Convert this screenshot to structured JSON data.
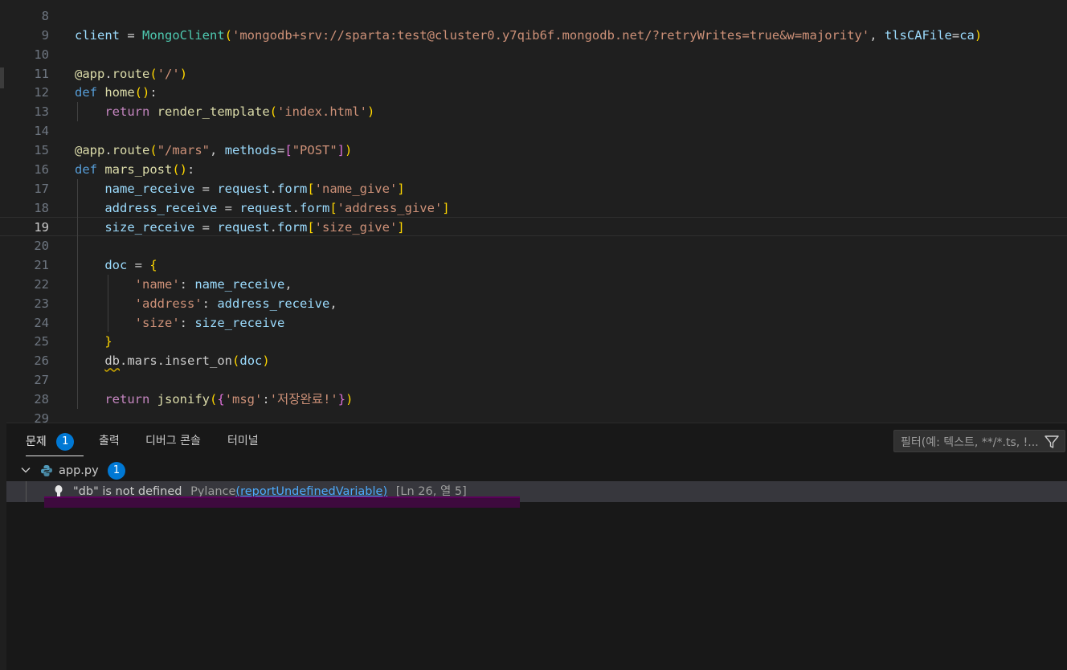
{
  "editor": {
    "lines": [
      {
        "n": "8",
        "segs": []
      },
      {
        "n": "9",
        "segs": [
          [
            "var",
            "client"
          ],
          [
            "pun",
            " = "
          ],
          [
            "cls",
            "MongoClient"
          ],
          [
            "brk1",
            "("
          ],
          [
            "str",
            "'mongodb+srv://sparta:test@cluster0.y7qib6f.mongodb.net/?retryWrites=true&w=majority'"
          ],
          [
            "pun",
            ", "
          ],
          [
            "var",
            "tlsCAFile"
          ],
          [
            "pun",
            "="
          ],
          [
            "var",
            "ca"
          ],
          [
            "brk1",
            ")"
          ]
        ]
      },
      {
        "n": "10",
        "segs": []
      },
      {
        "n": "11",
        "segs": [
          [
            "fn",
            "@app"
          ],
          [
            "pun",
            "."
          ],
          [
            "fn",
            "route"
          ],
          [
            "brk1",
            "("
          ],
          [
            "str",
            "'/'"
          ],
          [
            "brk1",
            ")"
          ]
        ]
      },
      {
        "n": "12",
        "segs": [
          [
            "kw",
            "def"
          ],
          [
            "pun",
            " "
          ],
          [
            "fn",
            "home"
          ],
          [
            "brk1",
            "()"
          ],
          [
            "pun",
            ":"
          ]
        ]
      },
      {
        "n": "13",
        "segs": [
          [
            "pun",
            "    "
          ],
          [
            "kw2",
            "return"
          ],
          [
            "pun",
            " "
          ],
          [
            "fn",
            "render_template"
          ],
          [
            "brk1",
            "("
          ],
          [
            "str",
            "'index.html'"
          ],
          [
            "brk1",
            ")"
          ]
        ]
      },
      {
        "n": "14",
        "segs": []
      },
      {
        "n": "15",
        "segs": [
          [
            "fn",
            "@app"
          ],
          [
            "pun",
            "."
          ],
          [
            "fn",
            "route"
          ],
          [
            "brk1",
            "("
          ],
          [
            "str",
            "\"/mars\""
          ],
          [
            "pun",
            ", "
          ],
          [
            "var",
            "methods"
          ],
          [
            "pun",
            "="
          ],
          [
            "brk2",
            "["
          ],
          [
            "str",
            "\"POST\""
          ],
          [
            "brk2",
            "]"
          ],
          [
            "brk1",
            ")"
          ]
        ]
      },
      {
        "n": "16",
        "segs": [
          [
            "kw",
            "def"
          ],
          [
            "pun",
            " "
          ],
          [
            "fn",
            "mars_post"
          ],
          [
            "brk1",
            "()"
          ],
          [
            "pun",
            ":"
          ]
        ]
      },
      {
        "n": "17",
        "segs": [
          [
            "pun",
            "    "
          ],
          [
            "var",
            "name_receive"
          ],
          [
            "pun",
            " = "
          ],
          [
            "var",
            "request"
          ],
          [
            "pun",
            "."
          ],
          [
            "var",
            "form"
          ],
          [
            "brk1",
            "["
          ],
          [
            "str",
            "'name_give'"
          ],
          [
            "brk1",
            "]"
          ]
        ]
      },
      {
        "n": "18",
        "segs": [
          [
            "pun",
            "    "
          ],
          [
            "var",
            "address_receive"
          ],
          [
            "pun",
            " = "
          ],
          [
            "var",
            "request"
          ],
          [
            "pun",
            "."
          ],
          [
            "var",
            "form"
          ],
          [
            "brk1",
            "["
          ],
          [
            "str",
            "'address_give'"
          ],
          [
            "brk1",
            "]"
          ]
        ]
      },
      {
        "n": "19",
        "segs": [
          [
            "pun",
            "    "
          ],
          [
            "var",
            "size_receive"
          ],
          [
            "pun",
            " = "
          ],
          [
            "var",
            "request"
          ],
          [
            "pun",
            "."
          ],
          [
            "var",
            "form"
          ],
          [
            "brk1",
            "["
          ],
          [
            "str",
            "'size_give'"
          ],
          [
            "brk1",
            "]"
          ]
        ]
      },
      {
        "n": "20",
        "segs": []
      },
      {
        "n": "21",
        "segs": [
          [
            "pun",
            "    "
          ],
          [
            "var",
            "doc"
          ],
          [
            "pun",
            " = "
          ],
          [
            "brk1",
            "{"
          ]
        ]
      },
      {
        "n": "22",
        "segs": [
          [
            "pun",
            "        "
          ],
          [
            "str",
            "'name'"
          ],
          [
            "pun",
            ": "
          ],
          [
            "var",
            "name_receive"
          ],
          [
            "pun",
            ","
          ]
        ]
      },
      {
        "n": "23",
        "segs": [
          [
            "pun",
            "        "
          ],
          [
            "str",
            "'address'"
          ],
          [
            "pun",
            ": "
          ],
          [
            "var",
            "address_receive"
          ],
          [
            "pun",
            ","
          ]
        ]
      },
      {
        "n": "24",
        "segs": [
          [
            "pun",
            "        "
          ],
          [
            "str",
            "'size'"
          ],
          [
            "pun",
            ": "
          ],
          [
            "var",
            "size_receive"
          ]
        ]
      },
      {
        "n": "25",
        "segs": [
          [
            "pun",
            "    "
          ],
          [
            "brk1",
            "}"
          ]
        ]
      },
      {
        "n": "26",
        "segs": [
          [
            "pun",
            "    "
          ],
          [
            "squig",
            "db"
          ],
          [
            "pun",
            "."
          ],
          [
            "pun",
            "mars"
          ],
          [
            "pun",
            "."
          ],
          [
            "pun",
            "insert_on"
          ],
          [
            "brk1",
            "("
          ],
          [
            "var",
            "doc"
          ],
          [
            "brk1",
            ")"
          ]
        ]
      },
      {
        "n": "27",
        "segs": []
      },
      {
        "n": "28",
        "segs": [
          [
            "pun",
            "    "
          ],
          [
            "kw2",
            "return"
          ],
          [
            "pun",
            " "
          ],
          [
            "fn",
            "jsonify"
          ],
          [
            "brk1",
            "("
          ],
          [
            "brk2",
            "{"
          ],
          [
            "str",
            "'msg'"
          ],
          [
            "pun",
            ":"
          ],
          [
            "str",
            "'저장완료!'"
          ],
          [
            "brk2",
            "}"
          ],
          [
            "brk1",
            ")"
          ]
        ]
      },
      {
        "n": "29",
        "segs": []
      }
    ],
    "active_line": "19"
  },
  "panel": {
    "tabs": [
      {
        "label": "문제",
        "active": true,
        "badge": "1"
      },
      {
        "label": "출력"
      },
      {
        "label": "디버그 콘솔"
      },
      {
        "label": "터미널"
      }
    ],
    "filter_placeholder": "필터(예: 텍스트, **/*.ts, !...",
    "file": {
      "name": "app.py",
      "count": "1"
    },
    "problem": {
      "message": "\"db\" is not defined",
      "source": "Pylance",
      "rule_open": "(",
      "rule": "reportUndefinedVariable",
      "rule_close": ")",
      "location": "[Ln 26, 열 5]"
    }
  },
  "colors": {
    "accent": "#0078d4",
    "link": "#4daafc",
    "warning": "#cca700"
  }
}
